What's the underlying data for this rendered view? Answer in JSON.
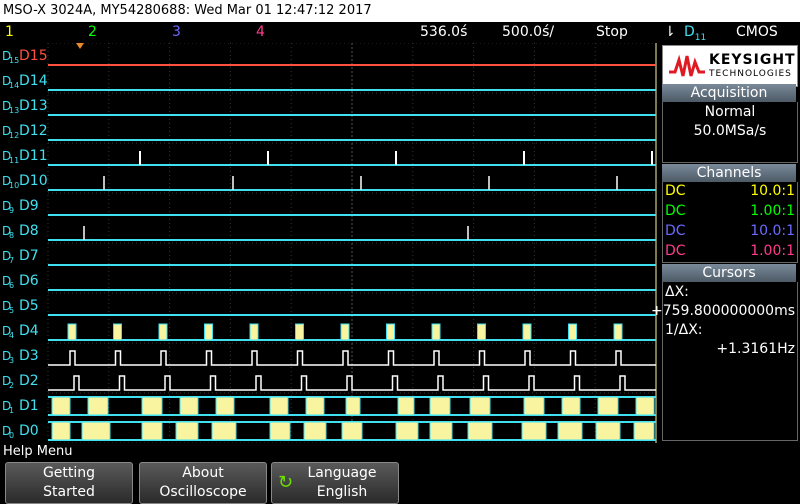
{
  "titlebar": {
    "text": "MSO-X 3024A, MY54280688: Wed Mar 01 12:47:12 2017"
  },
  "status": {
    "ch1": "1",
    "ch2": "2",
    "ch3": "3",
    "ch4": "4",
    "time_div": "536.0ś",
    "delay": "500.0ś/",
    "run_state": "Stop",
    "trigger_source": "D",
    "trigger_sub": "11",
    "logic_type": "CMOS"
  },
  "colors": {
    "ch1": "#ffff00",
    "ch2": "#00ff00",
    "ch3": "#6a6aff",
    "ch4": "#ff3c8c",
    "digital": "#40e0f0",
    "d15": "#ff5040",
    "bus_fill": "#f8f4a0"
  },
  "channels_digital": [
    {
      "id": "D15",
      "sub": "15",
      "label": "D15"
    },
    {
      "id": "D14",
      "sub": "14",
      "label": "D14"
    },
    {
      "id": "D13",
      "sub": "13",
      "label": "D13"
    },
    {
      "id": "D12",
      "sub": "12",
      "label": "D12"
    },
    {
      "id": "D11",
      "sub": "11",
      "label": "D11"
    },
    {
      "id": "D10",
      "sub": "10",
      "label": "D10"
    },
    {
      "id": "D9",
      "sub": "9",
      "label": "D9"
    },
    {
      "id": "D8",
      "sub": "8",
      "label": "D8"
    },
    {
      "id": "D7",
      "sub": "7",
      "label": "D7"
    },
    {
      "id": "D6",
      "sub": "6",
      "label": "D6"
    },
    {
      "id": "D5",
      "sub": "5",
      "label": "D5"
    },
    {
      "id": "D4",
      "sub": "4",
      "label": "D4"
    },
    {
      "id": "D3",
      "sub": "3",
      "label": "D3"
    },
    {
      "id": "D2",
      "sub": "2",
      "label": "D2"
    },
    {
      "id": "D1",
      "sub": "1",
      "label": "D1"
    },
    {
      "id": "D0",
      "sub": "0",
      "label": "D0"
    }
  ],
  "logo": {
    "brand": "KEYSIGHT",
    "tech": "TECHNOLOGIES"
  },
  "acquisition": {
    "title": "Acquisition",
    "mode": "Normal",
    "rate": "50.0MSa/s"
  },
  "channels_panel": {
    "title": "Channels",
    "rows": [
      {
        "coupling": "DC",
        "value": "10.0:1"
      },
      {
        "coupling": "DC",
        "value": "1.00:1"
      },
      {
        "coupling": "DC",
        "value": "10.0:1"
      },
      {
        "coupling": "DC",
        "value": "1.00:1"
      }
    ]
  },
  "cursors": {
    "title": "Cursors",
    "dx_label": "ΔX:",
    "dx_value": "+759.800000000ms",
    "inv_label": "1/ΔX:",
    "inv_value": "+1.3161Hz"
  },
  "help": {
    "label": "Help Menu"
  },
  "softkeys": [
    {
      "l1": "Getting",
      "l2": "Started"
    },
    {
      "l1": "About",
      "l2": "Oscilloscope"
    },
    {
      "l1": "Language",
      "l2": "English"
    }
  ]
}
